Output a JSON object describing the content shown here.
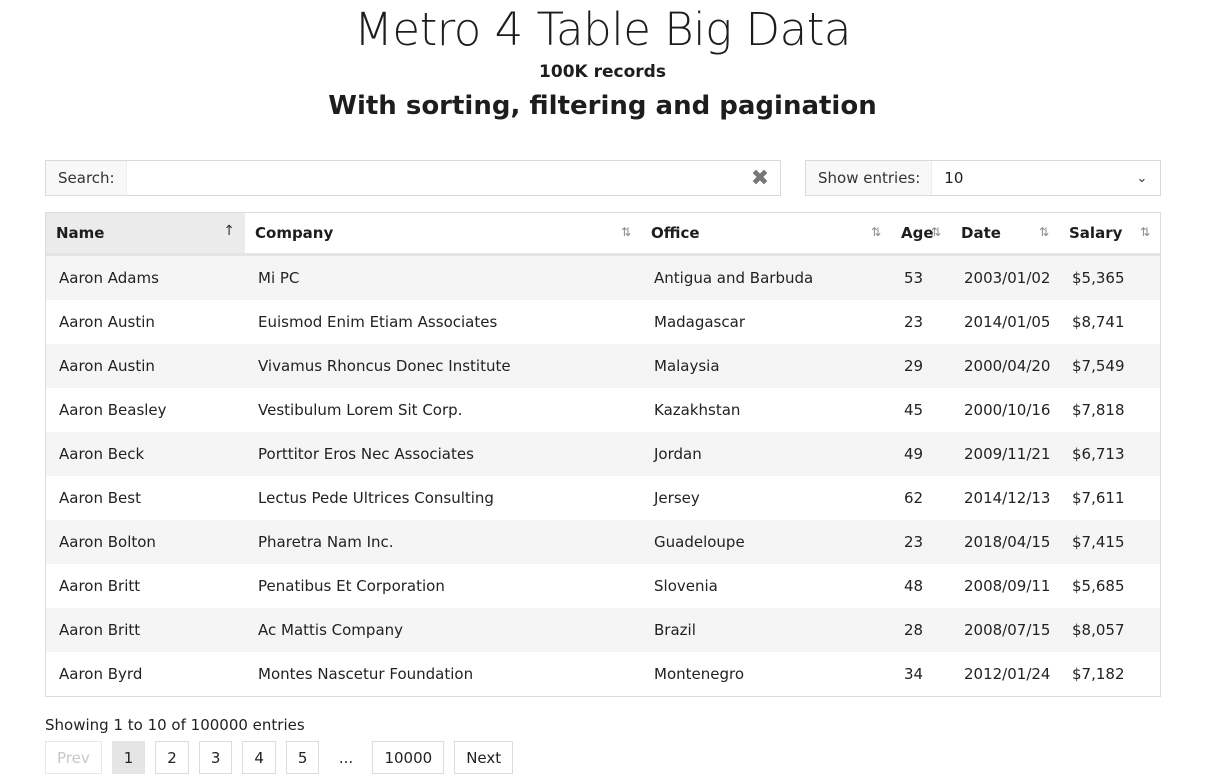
{
  "header": {
    "title": "Metro 4 Table Big Data",
    "subtitle": "100K records",
    "tagline": "With sorting, filtering and pagination"
  },
  "search": {
    "label": "Search:",
    "value": "",
    "placeholder": "",
    "clear_icon": "close-icon"
  },
  "entries": {
    "label": "Show entries:",
    "value": "10"
  },
  "table": {
    "columns": [
      {
        "label": "Name",
        "sort_icon": "↑"
      },
      {
        "label": "Company",
        "sort_icon": "⇅"
      },
      {
        "label": "Office",
        "sort_icon": "⇅"
      },
      {
        "label": "Age",
        "sort_icon": "⇅"
      },
      {
        "label": "Date",
        "sort_icon": "⇅"
      },
      {
        "label": "Salary",
        "sort_icon": "⇅"
      }
    ],
    "rows": [
      [
        "Aaron Adams",
        "Mi PC",
        "Antigua and Barbuda",
        "53",
        "2003/01/02",
        "$5,365"
      ],
      [
        "Aaron Austin",
        "Euismod Enim Etiam Associates",
        "Madagascar",
        "23",
        "2014/01/05",
        "$8,741"
      ],
      [
        "Aaron Austin",
        "Vivamus Rhoncus Donec Institute",
        "Malaysia",
        "29",
        "2000/04/20",
        "$7,549"
      ],
      [
        "Aaron Beasley",
        "Vestibulum Lorem Sit Corp.",
        "Kazakhstan",
        "45",
        "2000/10/16",
        "$7,818"
      ],
      [
        "Aaron Beck",
        "Porttitor Eros Nec Associates",
        "Jordan",
        "49",
        "2009/11/21",
        "$6,713"
      ],
      [
        "Aaron Best",
        "Lectus Pede Ultrices Consulting",
        "Jersey",
        "62",
        "2014/12/13",
        "$7,611"
      ],
      [
        "Aaron Bolton",
        "Pharetra Nam Inc.",
        "Guadeloupe",
        "23",
        "2018/04/15",
        "$7,415"
      ],
      [
        "Aaron Britt",
        "Penatibus Et Corporation",
        "Slovenia",
        "48",
        "2008/09/11",
        "$5,685"
      ],
      [
        "Aaron Britt",
        "Ac Mattis Company",
        "Brazil",
        "28",
        "2008/07/15",
        "$8,057"
      ],
      [
        "Aaron Byrd",
        "Montes Nascetur Foundation",
        "Montenegro",
        "34",
        "2012/01/24",
        "$7,182"
      ]
    ]
  },
  "status": "Showing 1 to 10 of 100000 entries",
  "pagination": {
    "prev": "Prev",
    "pages": [
      "1",
      "2",
      "3",
      "4",
      "5"
    ],
    "ellipsis": "...",
    "last": "10000",
    "next": "Next",
    "active": "1"
  }
}
